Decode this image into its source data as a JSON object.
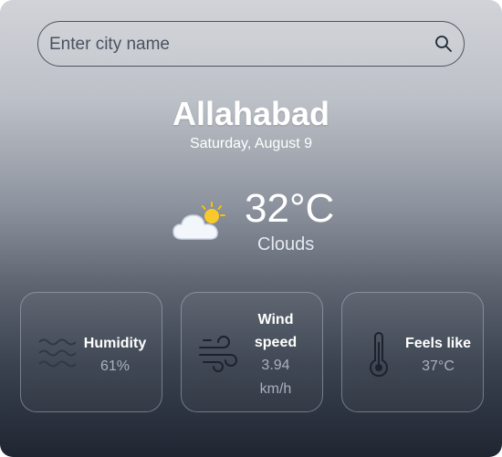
{
  "search": {
    "placeholder": "Enter city name",
    "value": ""
  },
  "location": {
    "city": "Allahabad",
    "date": "Saturday, August 9"
  },
  "current": {
    "temperature": "32°C",
    "condition": "Clouds",
    "icon": "partly-cloudy-icon"
  },
  "details": [
    {
      "label": "Humidity",
      "value": "61%",
      "icon": "humidity-waves-icon"
    },
    {
      "label_line1": "Wind",
      "label_line2": "speed",
      "value_line1": "3.94",
      "value_line2": "km/h",
      "icon": "wind-icon"
    },
    {
      "label": "Feels like",
      "value": "37°C",
      "icon": "thermometer-icon"
    }
  ],
  "colors": {
    "text": "#ffffff",
    "muted": "#a9b1bf",
    "sun": "#f5c400"
  }
}
